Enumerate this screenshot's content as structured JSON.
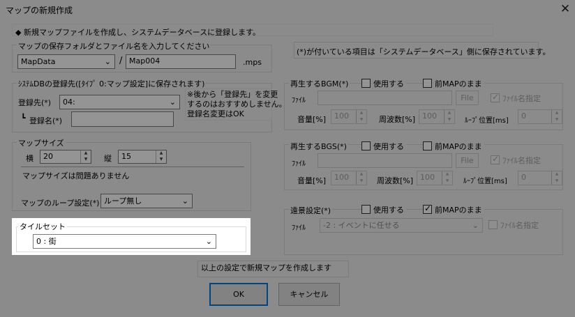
{
  "window": {
    "title": "マップの新規作成",
    "close_glyph": "✕"
  },
  "intro_text": "◆ 新規マップファイルを作成し、システムデータベースに登録します。",
  "save": {
    "label": "マップの保存フォルダとファイル名を入力してください",
    "folder": "MapData",
    "slash": "/",
    "filename": "Map004",
    "ext": ".mps"
  },
  "db_note": "(*)が付いている項目は「システムデータベース」側に保存されています。",
  "sysdb": {
    "label": "ｼｽﾃﾑDBの登録先([ﾀｲﾌﾟ 0:マップ設定]に保存されます)",
    "dest_label": "登録先(*)",
    "dest_value": "04:",
    "name_prefix": "┗",
    "name_label": "登録名(*)",
    "name_value": "",
    "note": [
      "※後から「登録先」を変更",
      "するのはおすすめしません。",
      "登録名変更はOK"
    ]
  },
  "mapsize": {
    "label": "マップサイズ",
    "width_label": "横",
    "width_value": "20",
    "height_label": "縦",
    "height_value": "15",
    "msg": "マップサイズは問題ありません",
    "loop_label": "マップのループ設定(*)",
    "loop_value": "ループ無し"
  },
  "tileset": {
    "label": "タイルセット",
    "value": "0 : 街"
  },
  "bgm": {
    "label": "再生するBGM(*)",
    "use_label": "使用する",
    "use_checked": false,
    "keep_label": "前MAPのまま",
    "keep_checked": false,
    "file_label": "ﾌｧｲﾙ",
    "file_value": "",
    "file_button": "File",
    "name_check_label": "ﾌｧｲﾙ名指定",
    "name_check_checked": true,
    "vol_label": "音量[%]",
    "vol_value": "100",
    "freq_label": "周波数[%]",
    "freq_value": "100",
    "loop_label": "ﾙｰﾌﾟ位置[ms]",
    "loop_value": "0"
  },
  "bgs": {
    "label": "再生するBGS(*)",
    "use_label": "使用する",
    "use_checked": false,
    "keep_label": "前MAPのまま",
    "keep_checked": false,
    "file_label": "ﾌｧｲﾙ",
    "file_value": "",
    "file_button": "File",
    "name_check_label": "ﾌｧｲﾙ名指定",
    "name_check_checked": true,
    "vol_label": "音量[%]",
    "vol_value": "100",
    "freq_label": "周波数[%]",
    "freq_value": "100",
    "loop_label": "ﾙｰﾌﾟ位置[ms]",
    "loop_value": "0"
  },
  "panorama": {
    "label": "遠景設定(*)",
    "use_label": "使用する",
    "use_checked": false,
    "keep_label": "前MAPのまま",
    "keep_checked": true,
    "file_label": "ﾌｧｲﾙ",
    "file_value": "-2 : イベントに任せる",
    "name_check_label": "ﾌｧｲﾙ名指定",
    "name_check_checked": false
  },
  "footer": {
    "msg": "以上の設定で新規マップを作成します",
    "ok_label": "OK",
    "cancel_label": "キャンセル"
  },
  "icons": {
    "chevron": "⌄",
    "spin_up": "▲",
    "spin_down": "▼"
  },
  "colors": {
    "overlay": "#000000",
    "default_button_border": "#0078d7"
  }
}
